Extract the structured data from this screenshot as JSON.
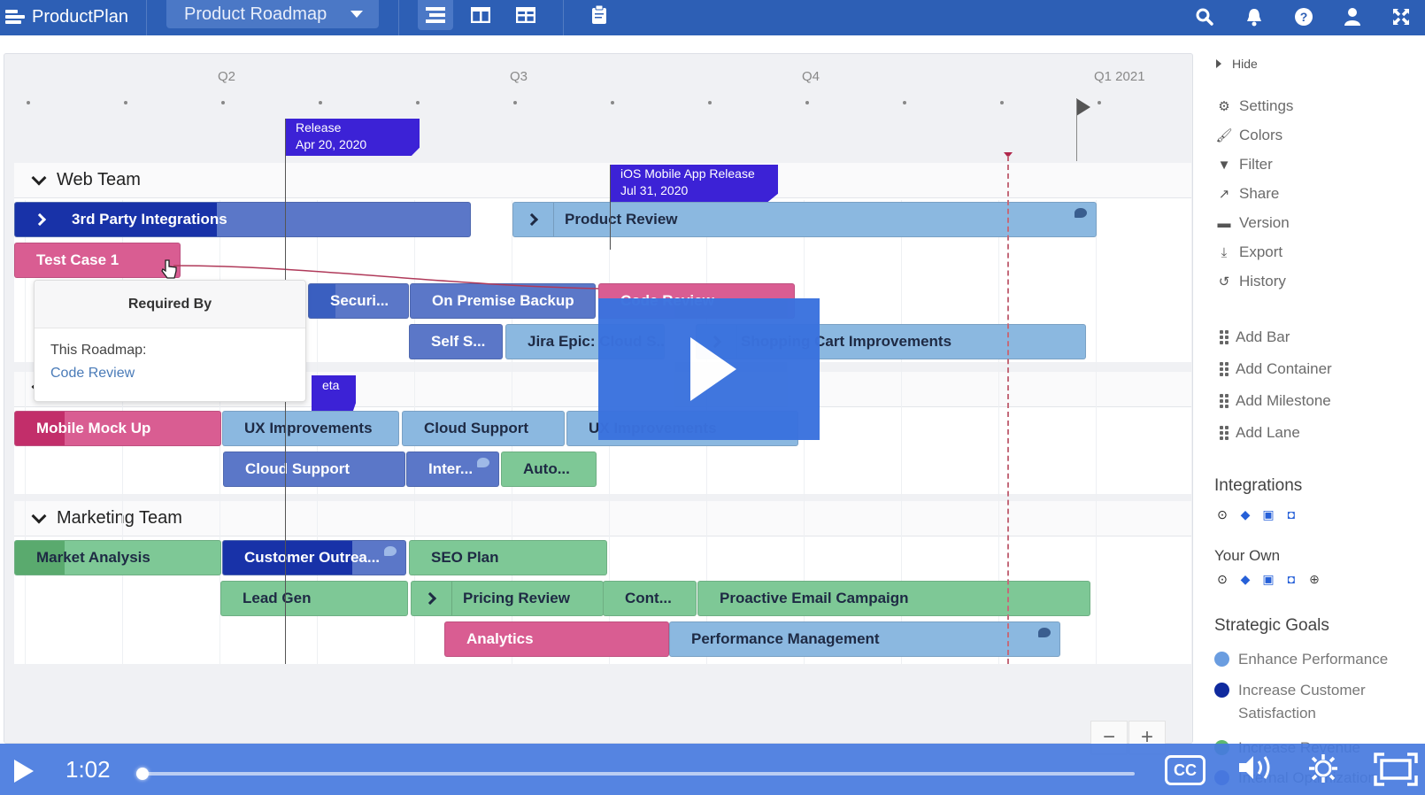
{
  "app": {
    "brand": "ProductPlan",
    "roadmap_selector": "Product Roadmap",
    "view_buttons": [
      "list-view",
      "board-view",
      "table-view"
    ],
    "clipboard_button": "clipboard"
  },
  "top_right_icons": [
    "search",
    "notifications",
    "help",
    "user",
    "fullscreen"
  ],
  "timeline": {
    "quarters": [
      "Q2",
      "Q3",
      "Q4",
      "Q1 2021"
    ],
    "milestones": [
      {
        "title": "Release",
        "date": "Apr 20, 2020"
      },
      {
        "title": "iOS Mobile App Release",
        "date": "Jul 31, 2020"
      },
      {
        "title": "eta",
        "date": ""
      }
    ]
  },
  "lanes": [
    {
      "name": "Web Team",
      "bars": [
        {
          "label": "3rd Party Integrations",
          "color": "blue",
          "container": true
        },
        {
          "label": "Product Review",
          "color": "lightblue",
          "container": true
        },
        {
          "label": "Test Case 1",
          "color": "pink"
        },
        {
          "label": "Securi...",
          "color": "blue"
        },
        {
          "label": "On Premise Backup",
          "color": "blue"
        },
        {
          "label": "Code Review",
          "color": "pink"
        },
        {
          "label": "Self S...",
          "color": "blue"
        },
        {
          "label": "Jira Epic: Cloud S...",
          "color": "lightblue"
        },
        {
          "label": "Shopping Cart Improvements",
          "color": "lightblue",
          "container": true
        }
      ]
    },
    {
      "name": "",
      "bars": [
        {
          "label": "Mobile Mock Up",
          "color": "pink"
        },
        {
          "label": "UX Improvements",
          "color": "lightblue"
        },
        {
          "label": "Cloud Support",
          "color": "lightblue"
        },
        {
          "label": "UX Improvements",
          "color": "lightblue"
        },
        {
          "label": "Cloud Support",
          "color": "blue"
        },
        {
          "label": "Inter...",
          "color": "blue"
        },
        {
          "label": "Auto...",
          "color": "green"
        }
      ]
    },
    {
      "name": "Marketing Team",
      "bars": [
        {
          "label": "Market Analysis",
          "color": "green"
        },
        {
          "label": "Customer Outrea...",
          "color": "darkblue"
        },
        {
          "label": "SEO Plan",
          "color": "green"
        },
        {
          "label": "Lead Gen",
          "color": "green"
        },
        {
          "label": "Pricing Review",
          "color": "green",
          "container": true
        },
        {
          "label": "Cont...",
          "color": "green"
        },
        {
          "label": "Proactive Email Campaign",
          "color": "green"
        },
        {
          "label": "Analytics",
          "color": "pink"
        },
        {
          "label": "Performance Management",
          "color": "lightblue"
        }
      ]
    }
  ],
  "tooltip": {
    "title": "Required By",
    "section": "This Roadmap:",
    "link": "Code Review"
  },
  "sidebar": {
    "hide": "Hide",
    "menu": [
      {
        "label": "Settings",
        "icon": "gear"
      },
      {
        "label": "Colors",
        "icon": "brush"
      },
      {
        "label": "Filter",
        "icon": "filter"
      },
      {
        "label": "Share",
        "icon": "share"
      },
      {
        "label": "Version",
        "icon": "archive"
      },
      {
        "label": "Export",
        "icon": "download"
      },
      {
        "label": "History",
        "icon": "history"
      }
    ],
    "add_items": [
      "Add Bar",
      "Add Container",
      "Add Milestone",
      "Add Lane"
    ],
    "integrations_title": "Integrations",
    "integrations": [
      "github",
      "jira",
      "trello",
      "pivotal"
    ],
    "your_own_title": "Your Own",
    "your_own": [
      "github",
      "jira",
      "trello",
      "pivotal",
      "add"
    ],
    "goals_title": "Strategic Goals",
    "goals": [
      {
        "label": "Enhance Performance",
        "color": "#6a9de0"
      },
      {
        "label": "Increase Customer Satisfaction",
        "color": "#0f2a9e"
      },
      {
        "label": "Increase Revenue",
        "color": "#5cb870"
      },
      {
        "label": "Internal Optimization",
        "color": "#4a5fd0"
      }
    ]
  },
  "zoom_controls": {
    "minus": "−",
    "plus": "+"
  },
  "video": {
    "time": "1:02",
    "progress": 0.0,
    "cc": "CC"
  },
  "colors": {
    "header": "#2d5fb5",
    "milestone": "#3c22d6",
    "lightblue": "#8bb8e0",
    "blue": "#5b77c8",
    "darkblue": "#1832a8",
    "green": "#7ec896",
    "pink": "#d95d92"
  }
}
